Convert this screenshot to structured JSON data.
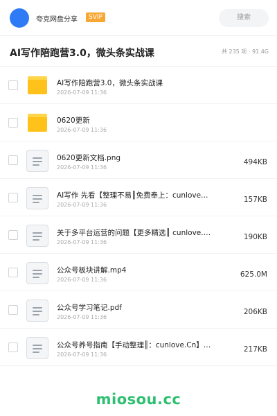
{
  "header": {
    "share_name": "夸克网盘分享",
    "badge": "SVIP",
    "search_label": "搜索"
  },
  "folder_title": "AI写作陪跑营3.0，微头条实战课",
  "summary": "共 235 项 · 91.4G",
  "items": [
    {
      "name": "AI写作陪跑营3.0，微头条实战课",
      "date": "2026-07-09 11:36",
      "size": "",
      "kind": "folder"
    },
    {
      "name": "0620更新",
      "date": "2026-07-09 11:36",
      "size": "",
      "kind": "folder"
    },
    {
      "name": "0620更新文档.png",
      "date": "2026-07-09 11:36",
      "size": "494KB",
      "kind": "file"
    },
    {
      "name": "AI写作 先看【整理不易║免费奉上：cunlove…",
      "date": "2026-07-09 11:36",
      "size": "157KB",
      "kind": "file"
    },
    {
      "name": "关于多平台运营的问题【更多精选║ cunlove.…",
      "date": "2026-07-09 11:36",
      "size": "190KB",
      "kind": "file"
    },
    {
      "name": "公众号板块讲解.mp4",
      "date": "2026-07-09 11:36",
      "size": "625.0M",
      "kind": "file"
    },
    {
      "name": "公众号学习笔记.pdf",
      "date": "2026-07-09 11:36",
      "size": "206KB",
      "kind": "file"
    },
    {
      "name": "公众号养号指南【手动整理║：cunlove.Cn】…",
      "date": "2026-07-09 11:36",
      "size": "217KB",
      "kind": "file"
    }
  ],
  "watermark": "miosou.cc",
  "colors": {
    "accent": "#2f7bf6",
    "svip": "#f7a734",
    "folder": "#ffc21a",
    "watermark": "#2fbf71"
  }
}
